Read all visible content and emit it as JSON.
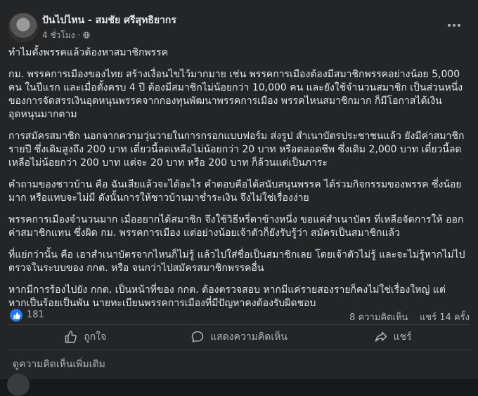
{
  "post": {
    "author": "ปันไปไหน - สมชัย ศรีสุทธิยากร",
    "time": "4 ชั่วโมง",
    "separator": "·",
    "paragraphs": [
      "ทำไมตั้งพรรคแล้วต้องหาสมาชิกพรรค",
      "กม. พรรคการเมืองของไทย สร้างเงื่อนไขไว้มากมาย เช่น พรรคการเมืองต้องมีสมาชิกพรรคอย่างน้อย 5,000\nคน ในปีแรก  และเมื่อตั้งครบ 4 ปี ต้องมีสมาชิกไม่น้อยกว่า 10,000 คน  และยังใช้จำนวนสมาชิก เป็นส่วนหนึ่ง\nของการจัดสรรเงินอุดหนุนพรรคจากกองทุนพัฒนาพรรคการเมือง  พรรคไหนสมาชิกมาก ก็มีโอกาสได้เงิน\nอุดหนุนมากตาม",
      "การสมัครสมาชิก นอกจากความวุ่นวายในการกรอกแบบฟอร์ม ส่งรูป สำเนาบัตรประชาชนแล้ว ยังมีค่าสมาชิก\nรายปี ซึ่งเดิมสูงถึง 200 บาท เดี๋ยวนี้ลดเหลือไม่น้อยกว่า 20 บาท หรือตลอดชีพ ซึ่งเดิม 2,000 บาท เดี๋ยวนี้ลด\nเหลือไม่น้อยกว่า 200 บาท แต่จะ 20 บาท หรือ 200 บาท ก็ล้วนแต่เป็นภาระ",
      "คำถามของชาวบ้าน คือ ฉันเสียแล้วจะได้อะไร คำตอบคือได้สนับสนุนพรรค ได้ร่วมกิจกรรมของพรรค ซึ่งน้อย\nมาก หรือแทบจะไม่มี  ดังนั้นการให้ชาวบ้านมาช่ำระเงิน จึงไม่ใช่เรื่องง่าย",
      "พรรคการเมืองจำนวนมาก เมื่ออยากได้สมาชิก จึงใช้วิธีหรี่ตาข้างหนึ่ง ขอแค่สำเนาบัตร ที่เหลือจัดการให้ ออก\nค่าสมาชิกแทน ซึ่งผิด กม. พรรคการเมือง แต่อย่างน้อยเจ้าตัวก็ยังรับรู้ว่า สมัครเป็นสมาชิกแล้ว",
      "ที่แย่กว่านั้น คือ เอาสำเนาบัตรจากไหนก็ไม่รู้ แล้วไปใส่ชื่อเป็นสมาชิกเลย โดยเจ้าตัวไม่รู้ และจะไม่รู้หากไม่ไป\nตรวจในระบบของ กกต. หรือ จนกว่าไปสมัครสมาชิกพรรคอื่น",
      "หากมีการร้องไปยัง กกต. เป็นหน้าที่ของ กกต. ต้องตรวจสอบ  หากมีแค่รายสองรายก็คงไม่ใช่เรื่องใหญ่ แต่\nหากเป็นร้อยเป็นพัน  นายทะเบียนพรรคการเมืองที่มีปัญหาคงต้องรับผิดชอบ"
    ]
  },
  "reactions": {
    "count": "181",
    "comments": "8 ความคิดเห็น",
    "shares": "แชร์ 14 ครั้ง"
  },
  "actions": {
    "like": "ถูกใจ",
    "comment": "แสดงความคิดเห็น",
    "share": "แชร์"
  },
  "more_comments": "ดูความคิดเห็นเพิ่มเติม",
  "colors": {
    "background": "#242526",
    "text": "#e4e6eb",
    "secondary_text": "#b0b3b8",
    "like_blue": "#2078f4"
  },
  "icons": {
    "audience": "globe-icon",
    "more": "more-horizontal-icon",
    "reaction": "thumbs-up-icon",
    "like": "like-outline-icon",
    "comment": "comment-bubble-icon",
    "share": "share-arrow-icon"
  }
}
